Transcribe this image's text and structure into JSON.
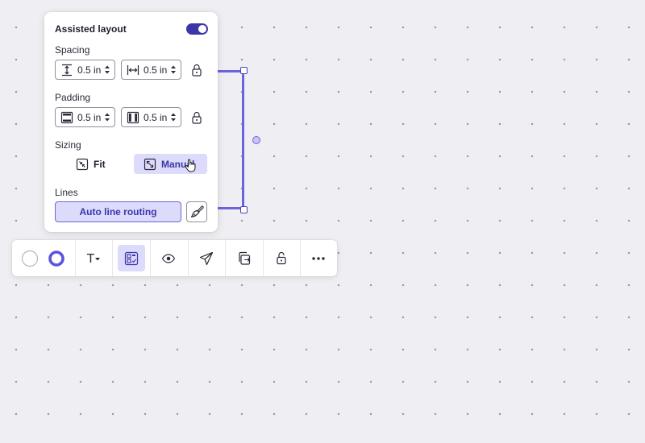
{
  "panel": {
    "title": "Assisted layout",
    "toggle_on": true,
    "spacing": {
      "label": "Spacing",
      "vertical_value": "0.5 in",
      "horizontal_value": "0.5 in"
    },
    "padding": {
      "label": "Padding",
      "vertical_value": "0.5 in",
      "horizontal_value": "0.5 in"
    },
    "sizing": {
      "label": "Sizing",
      "fit_label": "Fit",
      "manual_label": "Manual",
      "selected": "Manual"
    },
    "lines": {
      "label": "Lines",
      "auto_route_label": "Auto line routing"
    }
  },
  "toolbar": {
    "text_button_label": "T",
    "items": [
      "fill-color",
      "border-color",
      "text-style",
      "assisted-layout",
      "visibility",
      "send",
      "duplicate",
      "lock",
      "more"
    ],
    "active_item": "assisted-layout"
  },
  "colors": {
    "accent": "#6c63e0",
    "accent_dark": "#3b36a8",
    "accent_light": "#dcdbfb",
    "canvas": "#efeff3"
  }
}
